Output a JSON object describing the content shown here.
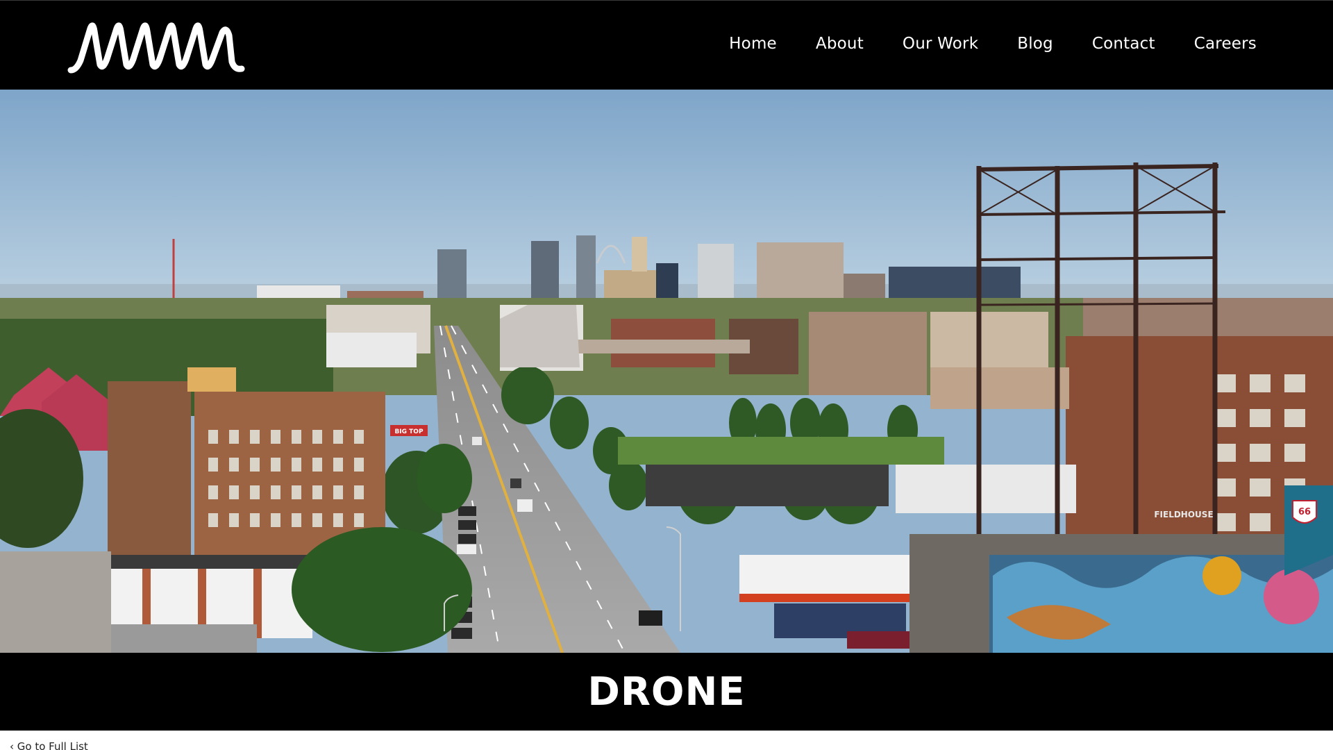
{
  "header": {
    "logo_text": "MMM",
    "nav": [
      {
        "label": "Home"
      },
      {
        "label": "About"
      },
      {
        "label": "Our Work"
      },
      {
        "label": "Blog"
      },
      {
        "label": "Contact"
      },
      {
        "label": "Careers"
      }
    ]
  },
  "hero": {
    "signs": {
      "big_top": "BIG TOP",
      "fieldhouse": "FIELDHOUSE",
      "route_66": "66"
    }
  },
  "page": {
    "title": "DRONE"
  },
  "footer_link": {
    "label": "Go to Full List"
  },
  "colors": {
    "header_bg": "#000000",
    "title_band_bg": "#000000",
    "text": "#ffffff"
  }
}
